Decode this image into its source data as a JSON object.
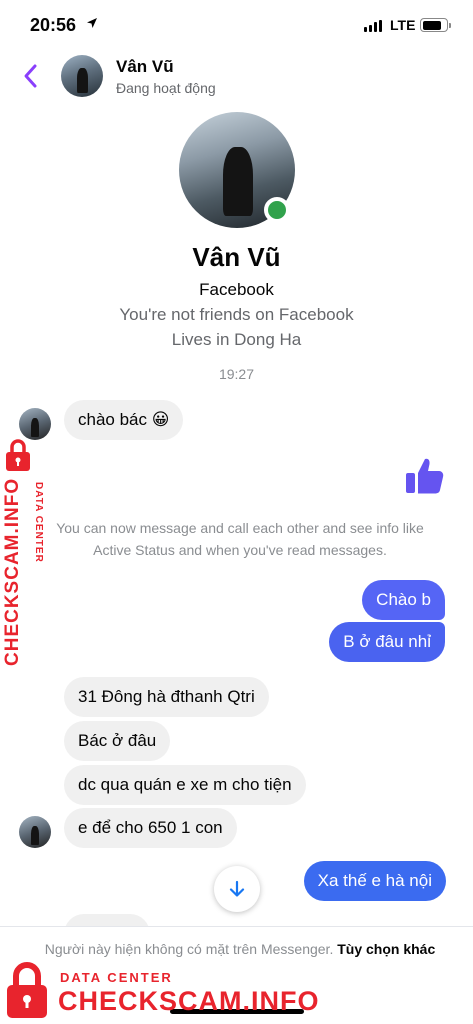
{
  "status_bar": {
    "time": "20:56",
    "network": "LTE"
  },
  "header": {
    "name": "Vân Vũ",
    "status": "Đang hoạt động"
  },
  "profile": {
    "name": "Vân Vũ",
    "source": "Facebook",
    "friend_status": "You're not friends on Facebook",
    "location": "Lives in Dong Ha"
  },
  "timestamp": "19:27",
  "messages": [
    {
      "direction": "in",
      "text": "chào bác 😀"
    },
    {
      "direction": "out",
      "type": "like"
    },
    {
      "direction": "out",
      "text": "Chào b"
    },
    {
      "direction": "out",
      "text": "B ở đâu nhỉ"
    },
    {
      "direction": "in",
      "text": "31 Đông hà đthanh Qtri"
    },
    {
      "direction": "in",
      "text": "Bác ở đâu"
    },
    {
      "direction": "in",
      "text": "dc qua quán e xe m cho tiện"
    },
    {
      "direction": "in",
      "text": "e để cho 650 1 con"
    },
    {
      "direction": "out",
      "text": "Xa thế e hà nội"
    }
  ],
  "notice": "You can now message and call each other and see info like Active Status and when you've read messages.",
  "footer": {
    "text": "Người này hiện không có mặt trên Messenger.",
    "link": "Tùy chọn khác"
  },
  "watermark": {
    "small": "DATA CENTER",
    "big": "CHECKSCAM.INFO"
  },
  "colors": {
    "accent": "#3b6bf0",
    "like": "#6554f0",
    "online": "#31a24c",
    "watermark": "#e8242d"
  }
}
